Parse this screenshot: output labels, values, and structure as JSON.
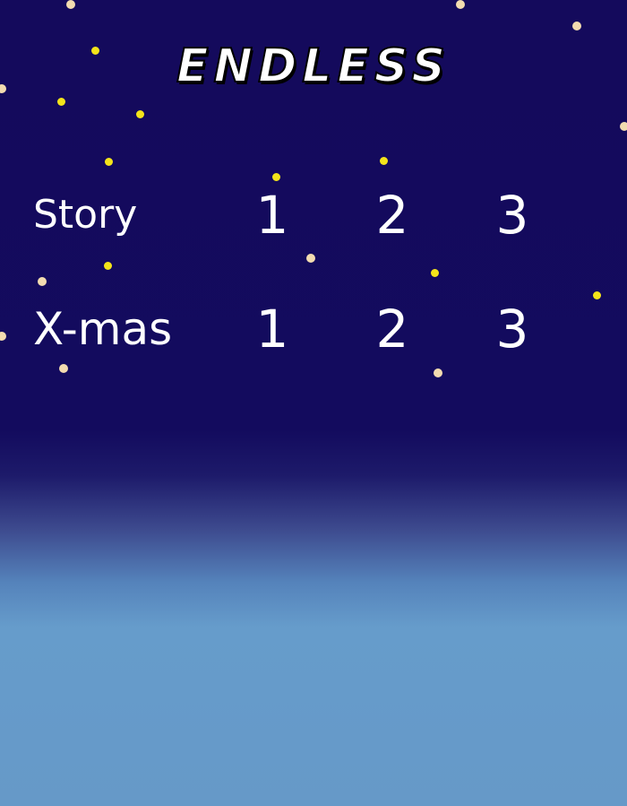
{
  "title": "ENDLESS",
  "modes": [
    {
      "label": "Story",
      "levels": [
        "1",
        "2",
        "3"
      ]
    },
    {
      "label": "X-mas",
      "levels": [
        "1",
        "2",
        "3"
      ]
    }
  ],
  "colors": {
    "sky_top": "#140a5c",
    "sky_bottom": "#6699c8",
    "text": "#ffffff",
    "star_yellow": "#f4e41a",
    "star_cream": "#f3dcb0"
  }
}
